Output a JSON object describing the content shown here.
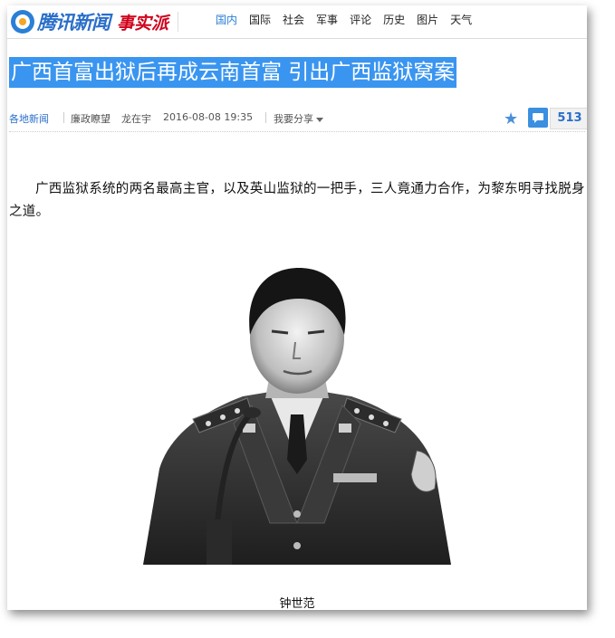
{
  "header": {
    "logo_text": "腾讯新闻",
    "logo_sub": "事实派",
    "nav": [
      "国内",
      "国际",
      "社会",
      "军事",
      "评论",
      "历史",
      "图片",
      "天气"
    ],
    "active_nav": "国内"
  },
  "article": {
    "title": "广西首富出狱后再成云南首富 引出广西监狱窝案",
    "source": "各地新闻",
    "column": "廉政瞭望",
    "author": "龙在宇",
    "datetime": "2016-08-08 19:35",
    "share_label": "我要分享",
    "comment_count": "513",
    "paragraph": "广西监狱系统的两名最高主官，以及英山监狱的一把手，三人竟通力合作，为黎东明寻找脱身之道。",
    "photo_caption": "钟世范"
  },
  "icons": {
    "logo": "tencent-news-logo",
    "star": "star-icon",
    "comment": "comment-icon",
    "share_caret": "caret-down-icon"
  },
  "colors": {
    "accent": "#2a7fd6",
    "headline_highlight": "#3a95f0",
    "brand_red": "#d0021b"
  }
}
